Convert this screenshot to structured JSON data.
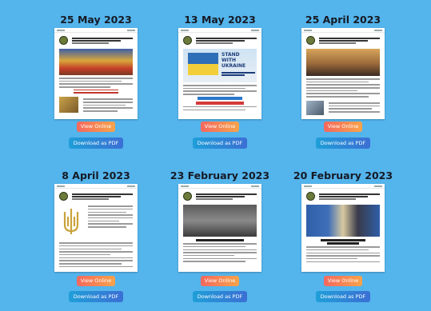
{
  "cards": [
    {
      "date": "25 May 2023",
      "view_label": "View Online",
      "download_label": "Download as PDF"
    },
    {
      "date": "13 May 2023",
      "view_label": "View Online",
      "download_label": "Download as PDF",
      "hero_text": "STAND WITH UKRAINE"
    },
    {
      "date": "25 April 2023",
      "view_label": "View Online",
      "download_label": "Download as PDF"
    },
    {
      "date": "8 April 2023",
      "view_label": "View Online",
      "download_label": "Download as PDF"
    },
    {
      "date": "23 February 2023",
      "view_label": "View Online",
      "download_label": "Download as PDF"
    },
    {
      "date": "20 February 2023",
      "view_label": "View Online",
      "download_label": "Download as PDF"
    }
  ],
  "colors": {
    "background": "#54b4ec",
    "view_button_gradient": [
      "#f4685e",
      "#f8a34a"
    ],
    "download_button_gradient": [
      "#1f9fd8",
      "#3b6fd4"
    ]
  }
}
